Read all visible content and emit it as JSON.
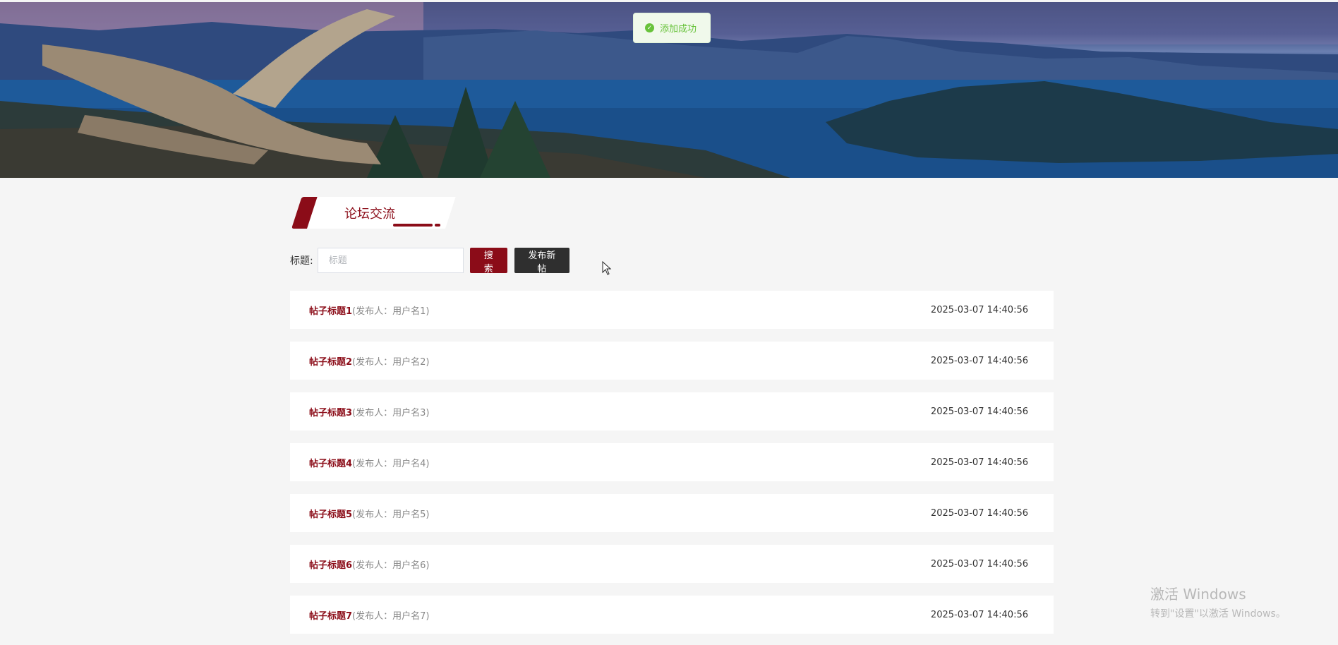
{
  "toast": {
    "message": "添加成功",
    "icon": "check-circle-icon",
    "color": "#67c23a"
  },
  "section": {
    "title": "论坛交流"
  },
  "search": {
    "label": "标题:",
    "placeholder": "标题",
    "search_button": "搜索",
    "publish_button": "发布新帖"
  },
  "posts": [
    {
      "title": "帖子标题1",
      "author": "(发布人：用户名1)",
      "time": "2025-03-07 14:40:56"
    },
    {
      "title": "帖子标题2",
      "author": "(发布人：用户名2)",
      "time": "2025-03-07 14:40:56"
    },
    {
      "title": "帖子标题3",
      "author": "(发布人：用户名3)",
      "time": "2025-03-07 14:40:56"
    },
    {
      "title": "帖子标题4",
      "author": "(发布人：用户名4)",
      "time": "2025-03-07 14:40:56"
    },
    {
      "title": "帖子标题5",
      "author": "(发布人：用户名5)",
      "time": "2025-03-07 14:40:56"
    },
    {
      "title": "帖子标题6",
      "author": "(发布人：用户名6)",
      "time": "2025-03-07 14:40:56"
    },
    {
      "title": "帖子标题7",
      "author": "(发布人：用户名7)",
      "time": "2025-03-07 14:40:56"
    }
  ],
  "watermark": {
    "line1": "激活 Windows",
    "line2": "转到\"设置\"以激活 Windows。"
  },
  "colors": {
    "accent": "#8b0c18",
    "dark_button": "#2f2f2f",
    "background": "#f5f5f5"
  }
}
